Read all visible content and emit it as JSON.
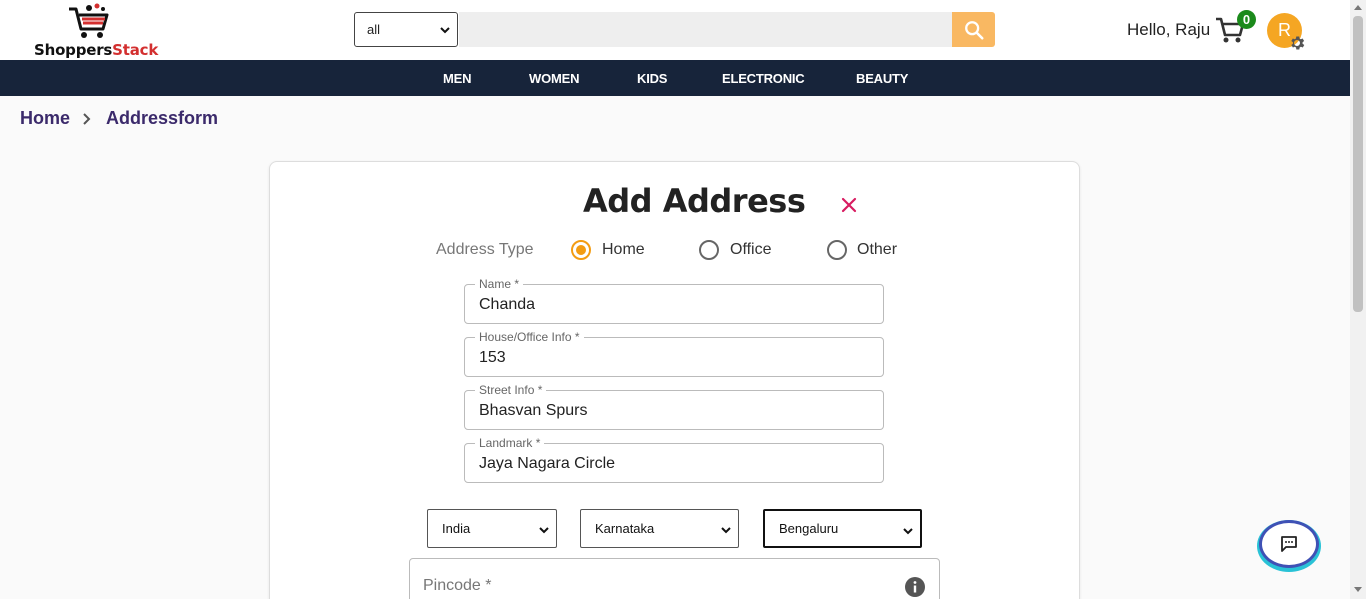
{
  "header": {
    "brand_part1": "Shoppers",
    "brand_part2": "Stack",
    "search_category": "all",
    "search_placeholder": "",
    "greeting": "Hello, Raju",
    "cart_count": "0",
    "avatar_initial": "R"
  },
  "nav": {
    "items": [
      "MEN",
      "WOMEN",
      "KIDS",
      "ELECTRONIC",
      "BEAUTY"
    ]
  },
  "breadcrumb": {
    "home": "Home",
    "current": "Addressform"
  },
  "form": {
    "title": "Add Address",
    "address_type_label": "Address Type",
    "address_types": [
      "Home",
      "Office",
      "Other"
    ],
    "selected_type": "Home",
    "fields": [
      {
        "label": "Name *",
        "value": "Chanda"
      },
      {
        "label": "House/Office Info *",
        "value": "153"
      },
      {
        "label": "Street Info *",
        "value": "Bhasvan Spurs"
      },
      {
        "label": "Landmark *",
        "value": "Jaya Nagara Circle"
      }
    ],
    "country": "India",
    "state": "Karnataka",
    "city": "Bengaluru",
    "pincode_label": "Pincode *"
  },
  "colors": {
    "nav_bg": "#17243a",
    "accent": "#f39c12",
    "search_button": "#f9b862",
    "close_icon": "#d81b60",
    "cart_badge": "#1b8a1b"
  },
  "icons": {
    "logo": "shopping-cart-logo-icon",
    "search": "search-icon",
    "cart": "cart-icon",
    "settings": "gear-icon",
    "close": "close-icon",
    "info": "info-icon",
    "chat": "chat-icon",
    "breadcrumb_separator": "chevron-right-icon"
  }
}
